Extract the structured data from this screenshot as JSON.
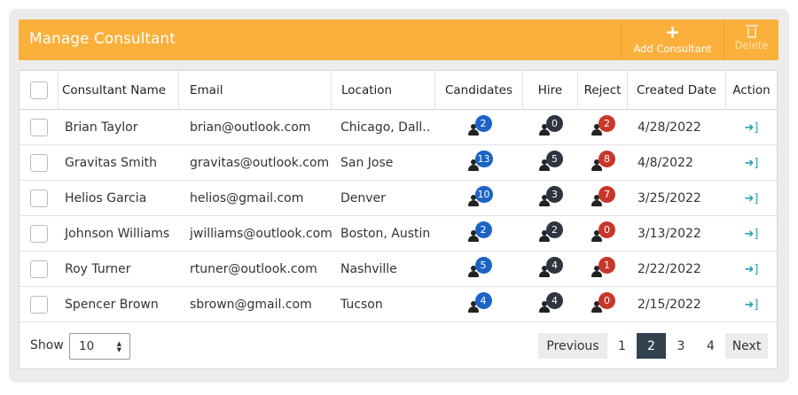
{
  "header": {
    "title": "Manage Consultant",
    "add_label": "Add Consultant",
    "add_icon": "plus-icon",
    "delete_label": "Delete",
    "delete_icon": "trash-icon",
    "accent_color": "#fbb03b"
  },
  "table": {
    "columns": [
      "Consultant Name",
      "Email",
      "Location",
      "Candidates",
      "Hire",
      "Reject",
      "Created Date",
      "Action"
    ],
    "rows": [
      {
        "name": "Brian Taylor",
        "email": "brian@outlook.com",
        "location": "Chicago, Dall..",
        "candidates": "2",
        "hire": "0",
        "reject": "2",
        "created": "4/28/2022"
      },
      {
        "name": "Gravitas Smith",
        "email": "gravitas@outlook.com",
        "location": "San Jose",
        "candidates": "13",
        "hire": "5",
        "reject": "8",
        "created": "4/8/2022"
      },
      {
        "name": "Helios Garcia",
        "email": "helios@gmail.com",
        "location": "Denver",
        "candidates": "10",
        "hire": "3",
        "reject": "7",
        "created": "3/25/2022"
      },
      {
        "name": "Johnson Williams",
        "email": "jwilliams@outlook.com",
        "location": "Boston, Austin",
        "candidates": "2",
        "hire": "2",
        "reject": "0",
        "created": "3/13/2022"
      },
      {
        "name": "Roy Turner",
        "email": "rtuner@outlook.com",
        "location": "Nashville",
        "candidates": "5",
        "hire": "4",
        "reject": "1",
        "created": "2/22/2022"
      },
      {
        "name": "Spencer Brown",
        "email": "sbrown@gmail.com",
        "location": "Tucson",
        "candidates": "4",
        "hire": "4",
        "reject": "0",
        "created": "2/15/2022"
      }
    ],
    "action_icon": "sign-in-icon",
    "badge_colors": {
      "candidates": "#1c64c4",
      "hire": "#2e3440",
      "reject": "#c8362a"
    }
  },
  "footer": {
    "show_label": "Show",
    "page_size": "10",
    "previous_label": "Previous",
    "pages": [
      "1",
      "2",
      "3",
      "4"
    ],
    "active_page": "2",
    "next_label": "Next"
  }
}
